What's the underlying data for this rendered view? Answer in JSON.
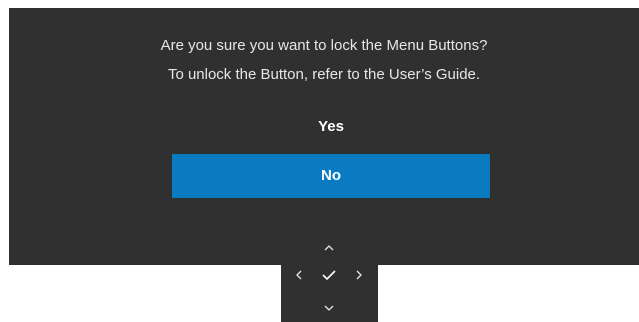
{
  "dialog": {
    "question": "Are you sure you want to lock the Menu Buttons?",
    "hint": "To unlock the Button, refer to the User’s Guide.",
    "options": [
      {
        "label": "Yes",
        "selected": false
      },
      {
        "label": "No",
        "selected": true
      }
    ],
    "accent_color": "#0a7bc1",
    "background_color": "#303030"
  },
  "nav_pad": {
    "buttons": [
      {
        "name": "up",
        "icon": "chevron-up-icon"
      },
      {
        "name": "left",
        "icon": "chevron-left-icon"
      },
      {
        "name": "ok",
        "icon": "checkmark-icon"
      },
      {
        "name": "right",
        "icon": "chevron-right-icon"
      },
      {
        "name": "down",
        "icon": "chevron-down-icon"
      }
    ]
  }
}
